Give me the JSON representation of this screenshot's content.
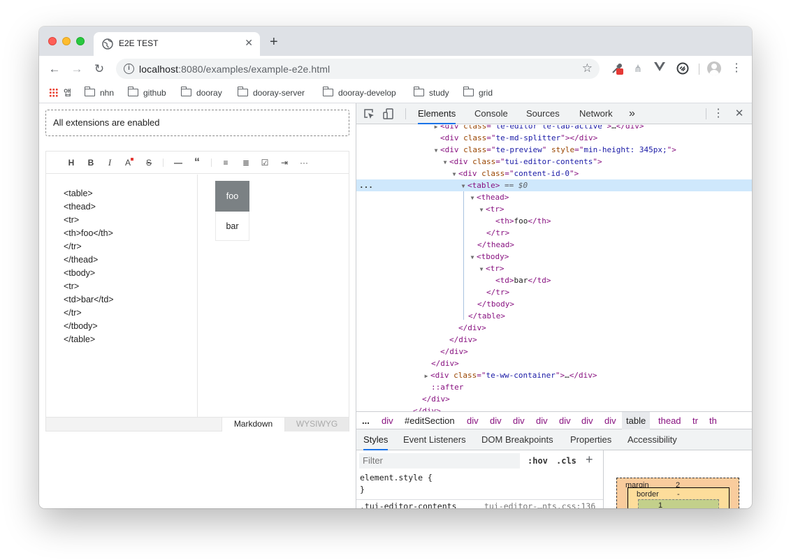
{
  "browser": {
    "tab_title": "E2E TEST",
    "url_host": "localhost",
    "url_rest": ":8080/examples/example-e2e.html",
    "bookmarks": [
      "앱",
      "nhn",
      "github",
      "dooray",
      "dooray-server",
      "dooray-develop",
      "study",
      "grid"
    ]
  },
  "page": {
    "extensions_message": "All extensions are enabled",
    "toolbar_buttons": [
      "H",
      "B",
      "I",
      "A",
      "S",
      "—",
      "“",
      "≡",
      "≣",
      "☑",
      "⇥",
      "···"
    ],
    "markdown_lines": [
      "<table>",
      "<thead>",
      "<tr>",
      "<th>foo</th>",
      "</tr>",
      "</thead>",
      "<tbody>",
      "<tr>",
      "<td>bar</td>",
      "</tr>",
      "</tbody>",
      "</table>"
    ],
    "preview_header": "foo",
    "preview_cell": "bar",
    "mode_markdown": "Markdown",
    "mode_wysiwyg": "WYSIWYG"
  },
  "devtools": {
    "tabs": [
      "Elements",
      "Console",
      "Sources",
      "Network"
    ],
    "more_tabs": "»",
    "selected_marker": "== $0",
    "ellipsis": "...",
    "breadcrumbs": [
      "div",
      "#editSection",
      "div",
      "div",
      "div",
      "div",
      "div",
      "div",
      "div",
      "table",
      "thead",
      "tr",
      "th"
    ],
    "style_tabs": [
      "Styles",
      "Event Listeners",
      "DOM Breakpoints",
      "Properties",
      "Accessibility"
    ],
    "filter_placeholder": "Filter",
    "hov": ":hov",
    "cls": ".cls",
    "element_style_open": "element.style {",
    "element_style_close": "}",
    "rule_selector": ".tui-editor-contents",
    "rule_source": "tui-editor-…nts.css:136",
    "box_margin_label": "margin",
    "box_margin_value": "2",
    "box_border_label": "border",
    "box_border_value": "-",
    "box_padding_value": "1"
  },
  "colors": {
    "accent": "#1a73e8",
    "tag": "#881280",
    "attr_name": "#994500",
    "attr_value": "#1a1aa6",
    "preview_header_bg": "#7b8184",
    "selected_row": "#cfe8fc"
  }
}
